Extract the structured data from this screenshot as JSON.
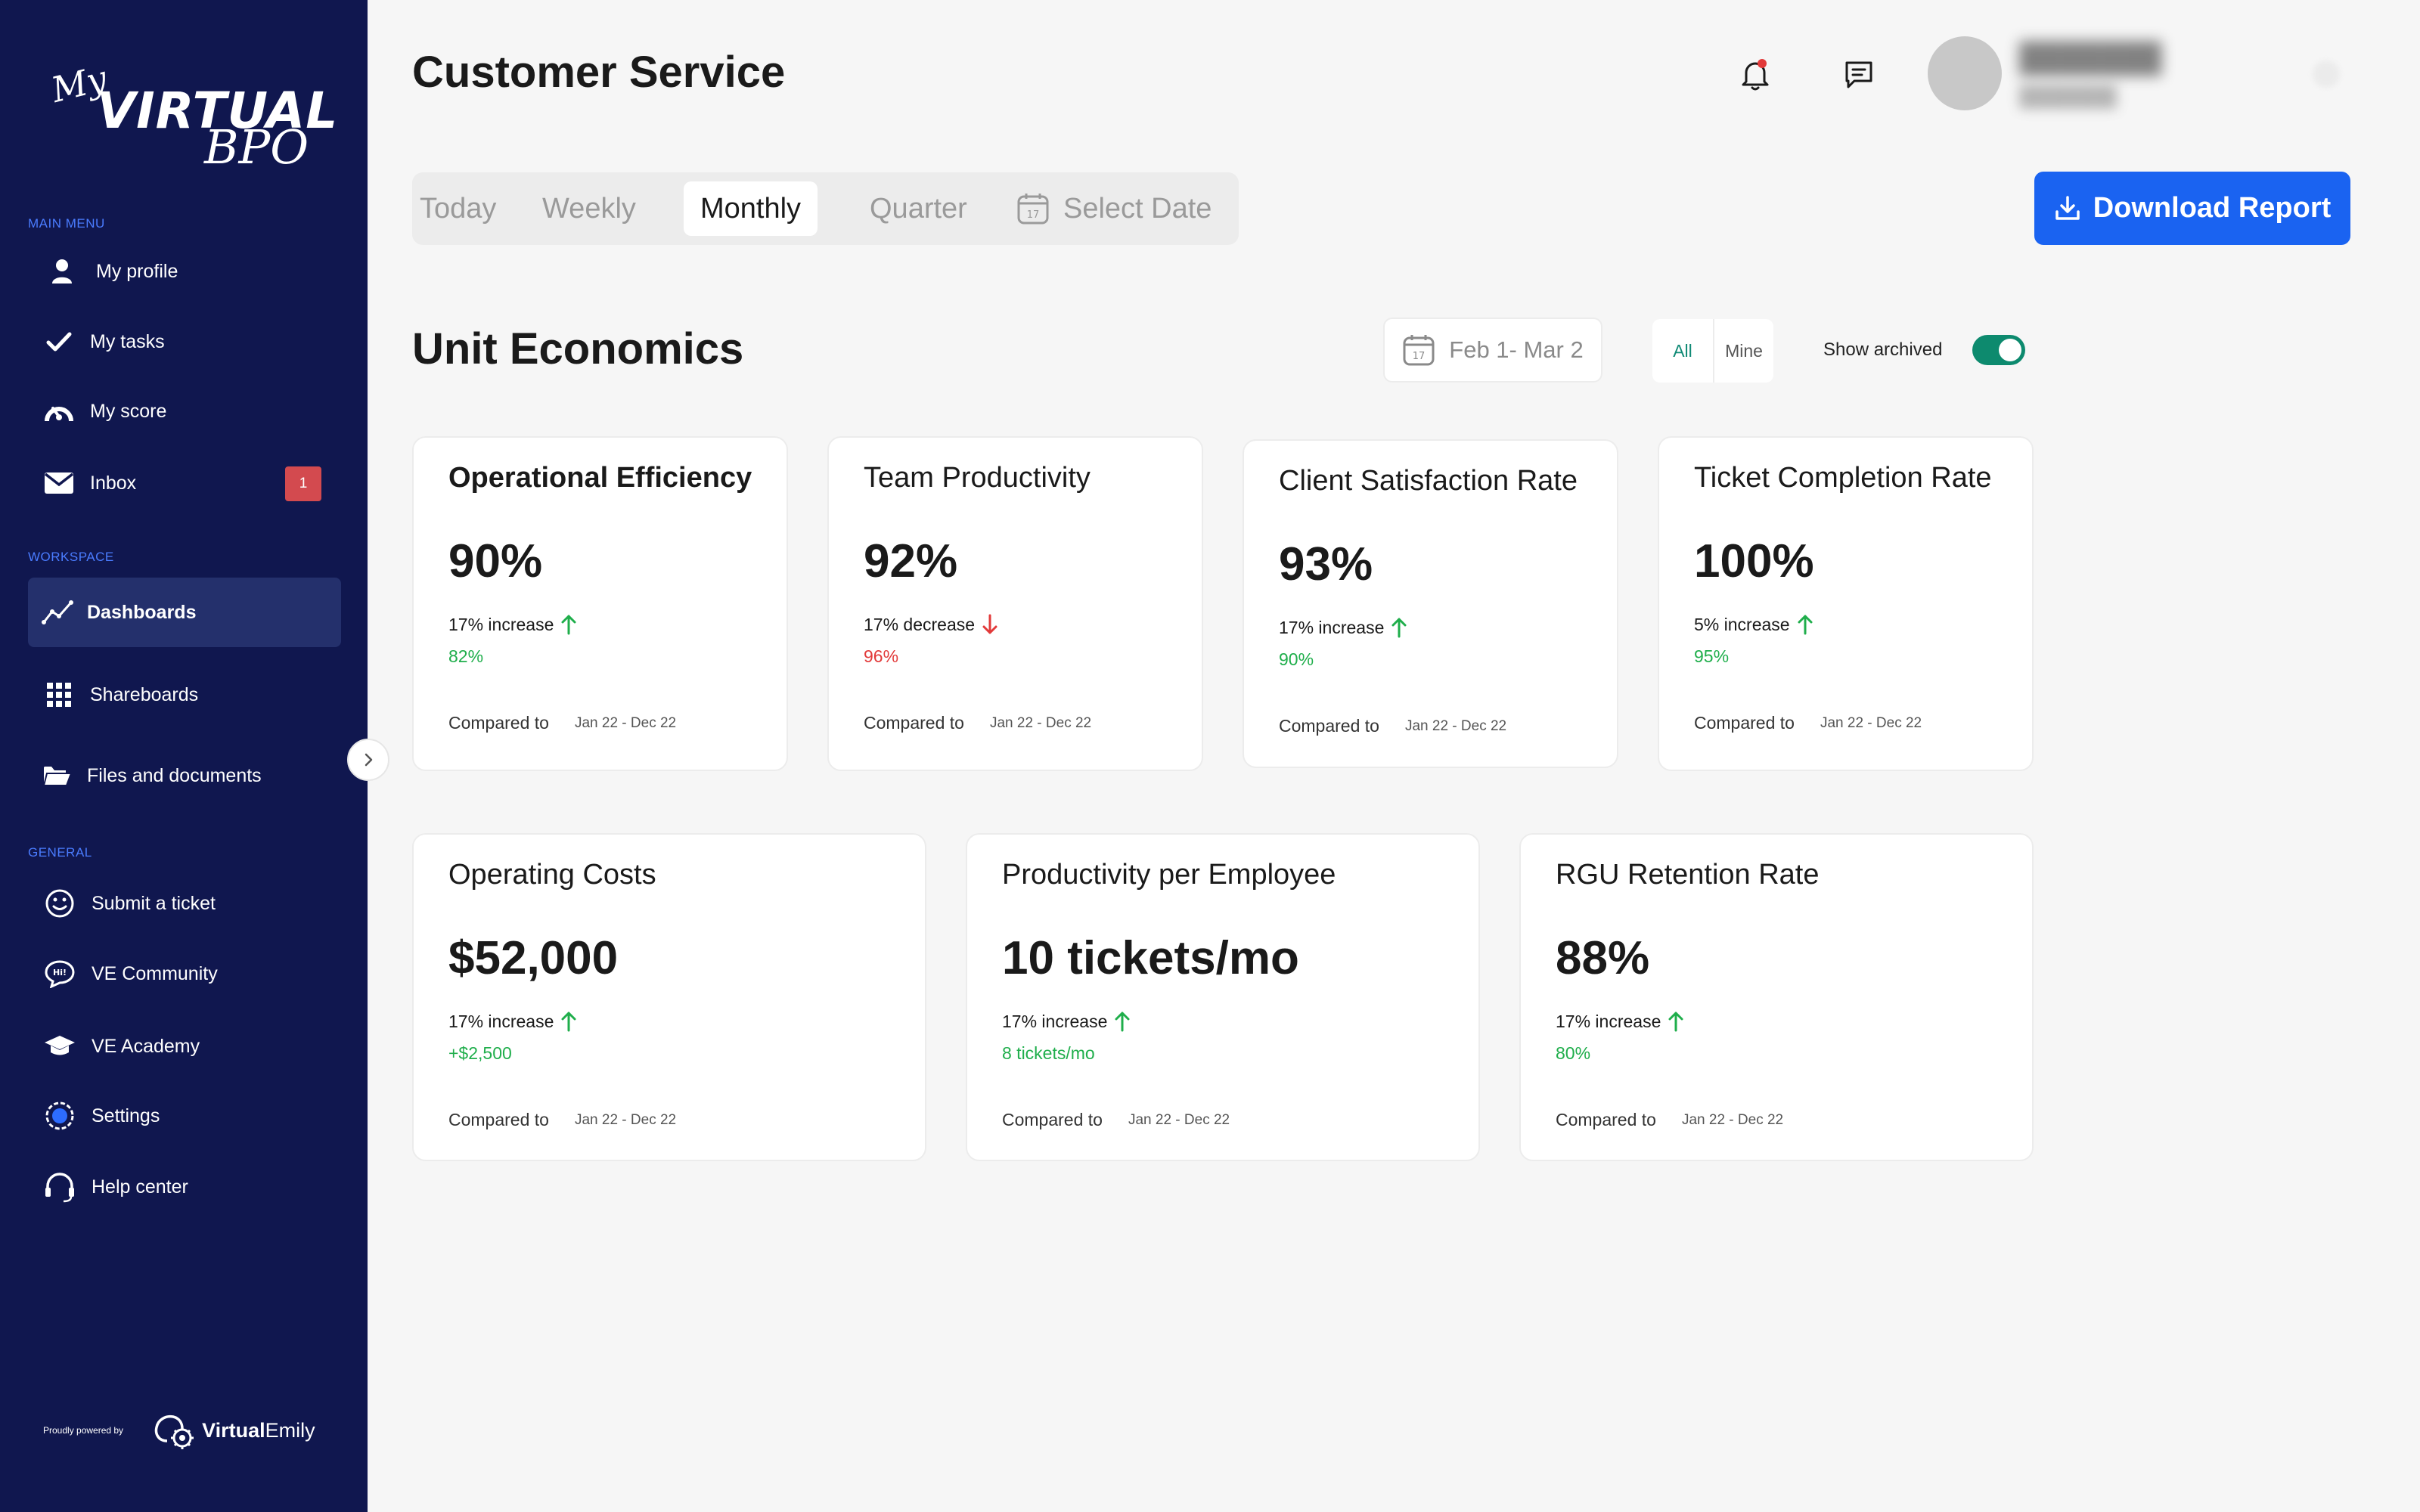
{
  "sidebar": {
    "logo": {
      "my": "My",
      "virtual": "VIRTUAL",
      "bpo": "BPO"
    },
    "sections": {
      "main": "MAIN MENU",
      "workspace": "WORKSPACE",
      "general": "GENERAL"
    },
    "items": [
      {
        "label": "My profile",
        "icon": "user-icon"
      },
      {
        "label": "My tasks",
        "icon": "check-icon"
      },
      {
        "label": "My score",
        "icon": "gauge-icon"
      },
      {
        "label": "Inbox",
        "icon": "mail-icon",
        "badge": "1"
      },
      {
        "label": "Dashboards",
        "icon": "chart-line-icon",
        "active": true
      },
      {
        "label": "Shareboards",
        "icon": "grid-icon"
      },
      {
        "label": "Files and documents",
        "icon": "folder-icon"
      },
      {
        "label": "Submit a ticket",
        "icon": "smiley-icon"
      },
      {
        "label": "VE Community",
        "icon": "chat-bubble-icon"
      },
      {
        "label": "VE Academy",
        "icon": "graduation-cap-icon"
      },
      {
        "label": "Settings",
        "icon": "settings-icon"
      },
      {
        "label": "Help center",
        "icon": "headset-icon"
      }
    ],
    "powered_by": "Proudly powered by",
    "brand_bold": "Virtual",
    "brand_regular": "Emily"
  },
  "header": {
    "title": "Customer Service"
  },
  "period_tabs": [
    "Today",
    "Weekly",
    "Monthly",
    "Quarter",
    "Select Date"
  ],
  "active_period": "Monthly",
  "download_label": "Download Report",
  "unit_economics": {
    "title": "Unit Economics",
    "date_range": "Feb 1- Mar 2",
    "filters": [
      "All",
      "Mine"
    ],
    "show_archived_label": "Show archived",
    "show_archived": true
  },
  "cards": [
    {
      "title": "Operational Efficiency",
      "value": "90%",
      "change": "17% increase",
      "direction": "up",
      "previous": "82%",
      "compare_label": "Compared to",
      "compare_period": "Jan 22 - Dec 22"
    },
    {
      "title": "Team Productivity",
      "value": "92%",
      "change": "17% decrease",
      "direction": "down",
      "previous": "96%",
      "compare_label": "Compared to",
      "compare_period": "Jan 22 - Dec 22"
    },
    {
      "title": "Client Satisfaction Rate",
      "value": "93%",
      "change": "17% increase",
      "direction": "up",
      "previous": "90%",
      "compare_label": "Compared to",
      "compare_period": "Jan 22 - Dec 22"
    },
    {
      "title": "Ticket Completion Rate",
      "value": "100%",
      "change": "5% increase",
      "direction": "up",
      "previous": "95%",
      "compare_label": "Compared to",
      "compare_period": "Jan 22 - Dec 22"
    },
    {
      "title": "Operating Costs",
      "value": "$52,000",
      "change": "17% increase",
      "direction": "up",
      "previous": "+$2,500",
      "compare_label": "Compared to",
      "compare_period": "Jan 22 - Dec 22"
    },
    {
      "title": "Productivity per Employee",
      "value": "10 tickets/mo",
      "change": "17% increase",
      "direction": "up",
      "previous": "8 tickets/mo",
      "compare_label": "Compared to",
      "compare_period": "Jan 22 - Dec 22"
    },
    {
      "title": "RGU Retention Rate",
      "value": "88%",
      "change": "17% increase",
      "direction": "up",
      "previous": "80%",
      "compare_label": "Compared to",
      "compare_period": "Jan 22 - Dec 22"
    }
  ],
  "colors": {
    "sidebar_bg": "#10174f",
    "accent_blue": "#1a63f1",
    "increase_green": "#1fae4b",
    "decrease_red": "#e23a3a",
    "toggle_green": "#0d8a6e"
  }
}
